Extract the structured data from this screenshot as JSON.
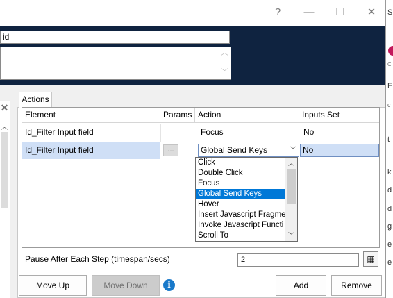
{
  "window": {
    "help_label": "?",
    "minimize_label": "—",
    "maximize_label": "☐",
    "close_label": "✕"
  },
  "header": {
    "id_value": "id",
    "description_value": ""
  },
  "tab": {
    "label": "Actions"
  },
  "grid": {
    "columns": [
      "Element",
      "Params",
      "Action",
      "Inputs Set"
    ],
    "rows": [
      {
        "element": "Id_Filter Input field",
        "params": "",
        "action": "Focus",
        "inputs_set": "No"
      },
      {
        "element": "Id_Filter Input field",
        "params": "...",
        "action": "Global Send Keys",
        "inputs_set": "No"
      }
    ]
  },
  "dropdown": {
    "options": [
      "Click",
      "Double Click",
      "Focus",
      "Global Send Keys",
      "Hover",
      "Insert Javascript Fragme",
      "Invoke Javascript Functi",
      "Scroll To"
    ],
    "selected": "Global Send Keys"
  },
  "pause": {
    "label": "Pause After Each Step (timespan/secs)",
    "value": "2"
  },
  "buttons": {
    "move_up": "Move Up",
    "move_down": "Move Down",
    "add": "Add",
    "remove": "Remove"
  },
  "right_edge": {
    "texts": [
      "S",
      "C",
      "E",
      "c",
      "t",
      "k",
      "d",
      "d",
      "g",
      "e",
      "e"
    ]
  },
  "colors": {
    "header_bg": "#0f2340",
    "selection": "#0078d7",
    "row_highlight": "#cfdff6",
    "info_blue": "#1979ca"
  }
}
